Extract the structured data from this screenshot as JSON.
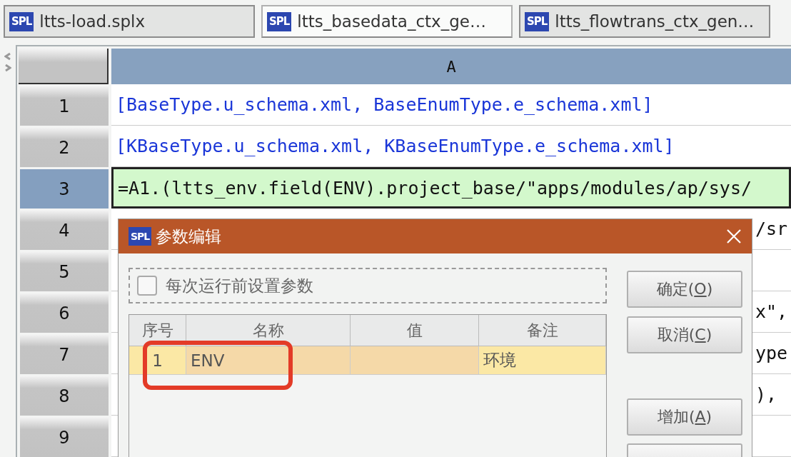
{
  "tabs": [
    {
      "badge": "SPL",
      "label": "ltts-load.splx",
      "selected": false
    },
    {
      "badge": "SPL",
      "label": "ltts_basedata_ctx_ge…",
      "selected": true
    },
    {
      "badge": "SPL",
      "label": "ltts_flowtrans_ctx_gen…",
      "selected": false
    }
  ],
  "sheet": {
    "columns": [
      {
        "label": "A",
        "selected": true
      }
    ],
    "rows": [
      {
        "number": "1",
        "selected": false,
        "kind": "full",
        "cell": "[BaseType.u_schema.xml, BaseEnumType.e_schema.xml]"
      },
      {
        "number": "2",
        "selected": false,
        "kind": "full",
        "cell": "[KBaseType.u_schema.xml, KBaseEnumType.e_schema.xml]"
      },
      {
        "number": "3",
        "selected": true,
        "kind": "full",
        "cell": "=A1.(ltts_env.field(ENV).project_base/\"apps/modules/ap/sys/"
      },
      {
        "number": "4",
        "selected": false,
        "kind": "tail",
        "cell": "/sr"
      },
      {
        "number": "5",
        "selected": false
      },
      {
        "number": "6",
        "selected": false,
        "kind": "tail",
        "cell": "x\","
      },
      {
        "number": "7",
        "selected": false,
        "kind": "tail",
        "cell": "ype"
      },
      {
        "number": "8",
        "selected": false,
        "kind": "tail",
        "cell": "),"
      },
      {
        "number": "9",
        "selected": false
      }
    ]
  },
  "dialog": {
    "badge": "SPL",
    "title": "参数编辑",
    "option": {
      "label": "每次运行前设置参数",
      "checked": false
    },
    "table": {
      "columns": [
        "序号",
        "名称",
        "值",
        "备注"
      ],
      "rows": [
        {
          "index": "1",
          "name": "ENV",
          "note": "环境",
          "selected": true
        }
      ]
    },
    "buttons": [
      {
        "kind": "labeled",
        "label": "确定(O)"
      },
      {
        "kind": "labeled",
        "label": "取消(C)"
      },
      {
        "kind": "spaced",
        "label": "增加(A)"
      },
      {
        "kind": "cut"
      }
    ]
  }
}
